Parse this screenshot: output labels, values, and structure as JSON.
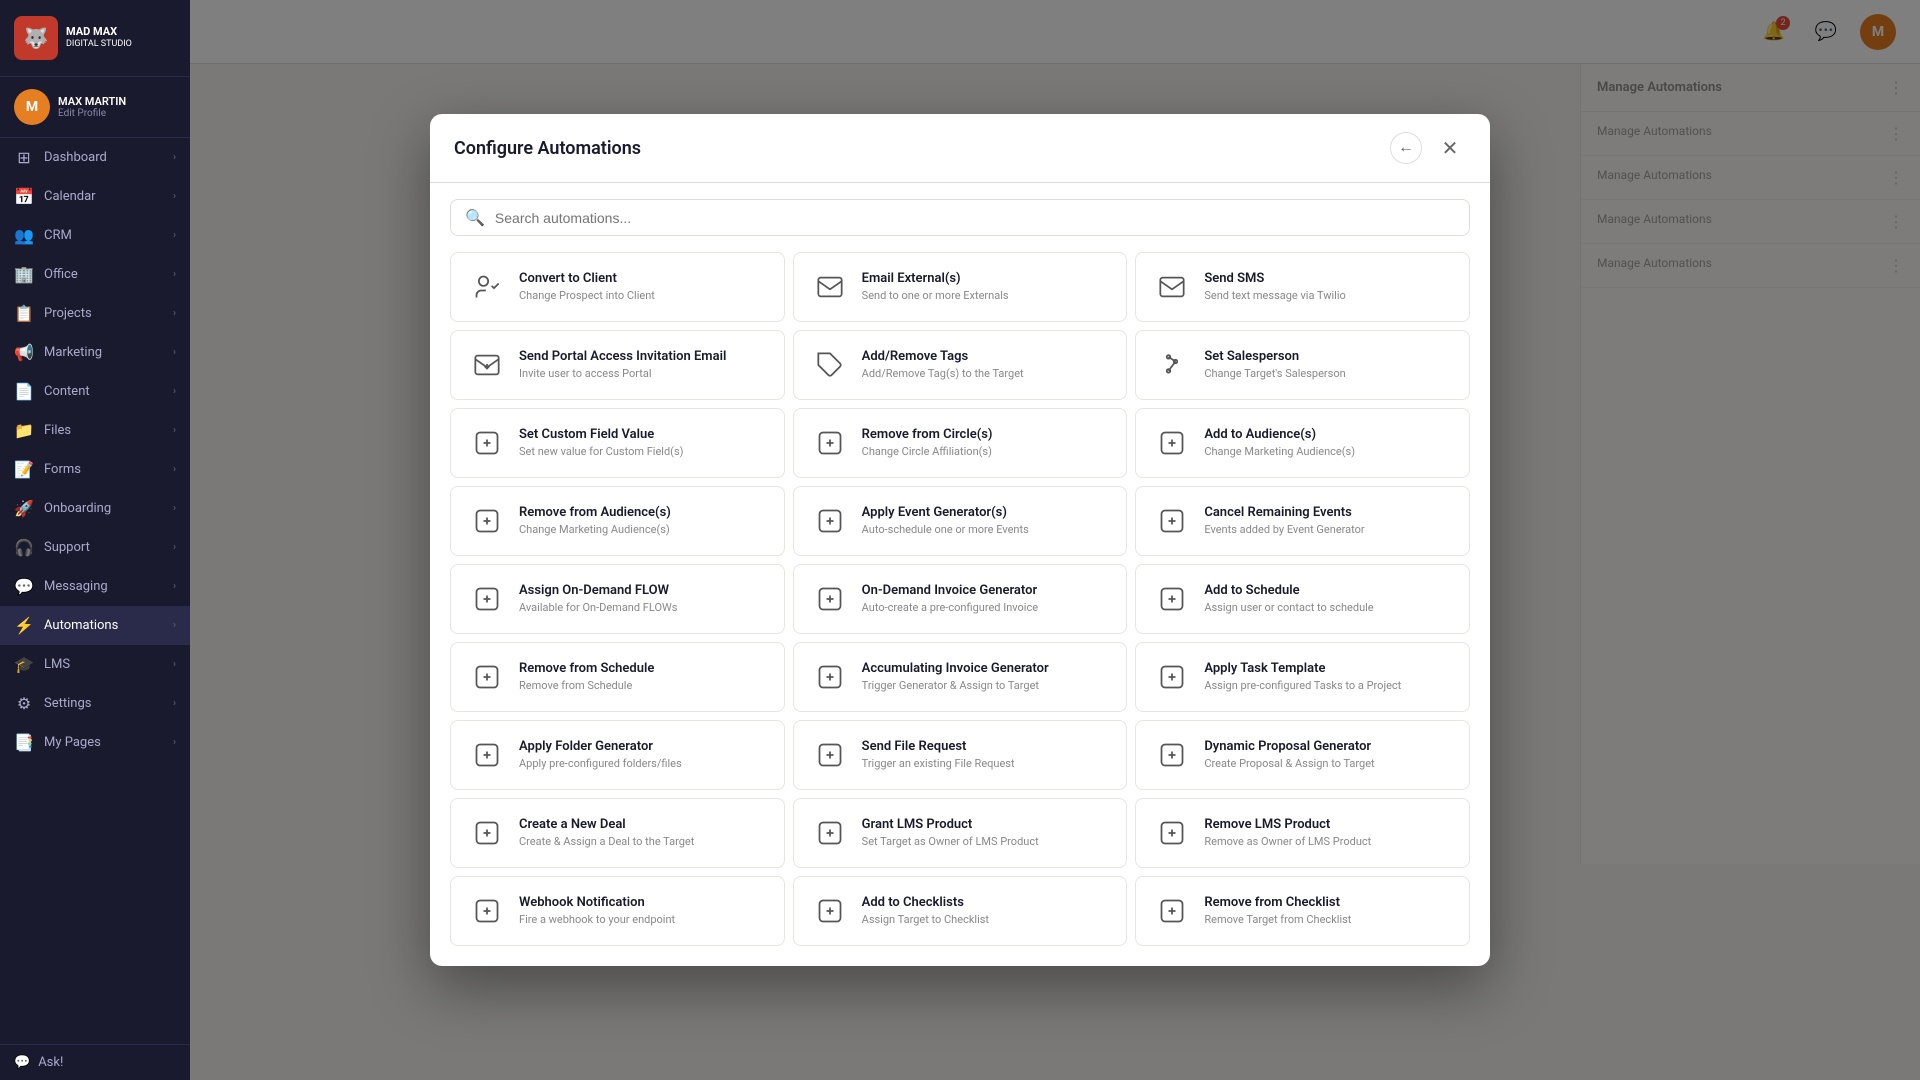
{
  "app": {
    "name": "MAD MAX",
    "subtitle": "digital studio"
  },
  "sidebar": {
    "user": {
      "name": "MAX MARTIN",
      "edit": "Edit Profile"
    },
    "items": [
      {
        "label": "Dashboard",
        "icon": "⊞",
        "hasChildren": true
      },
      {
        "label": "Calendar",
        "icon": "📅",
        "hasChildren": true
      },
      {
        "label": "CRM",
        "icon": "👥",
        "hasChildren": true
      },
      {
        "label": "Office",
        "icon": "🏢",
        "hasChildren": true
      },
      {
        "label": "Projects",
        "icon": "📋",
        "hasChildren": true
      },
      {
        "label": "Marketing",
        "icon": "📢",
        "hasChildren": true
      },
      {
        "label": "Content",
        "icon": "📄",
        "hasChildren": true
      },
      {
        "label": "Files",
        "icon": "📁",
        "hasChildren": true
      },
      {
        "label": "Forms",
        "icon": "📝",
        "hasChildren": true
      },
      {
        "label": "Onboarding",
        "icon": "🚀",
        "hasChildren": true
      },
      {
        "label": "Support",
        "icon": "🎧",
        "hasChildren": true
      },
      {
        "label": "Messaging",
        "icon": "💬",
        "hasChildren": true
      },
      {
        "label": "Automations",
        "icon": "⚡",
        "hasChildren": true,
        "active": true
      },
      {
        "label": "LMS",
        "icon": "🎓",
        "hasChildren": true
      },
      {
        "label": "Settings",
        "icon": "⚙",
        "hasChildren": true
      },
      {
        "label": "My Pages",
        "icon": "📑",
        "hasChildren": true
      }
    ],
    "askLabel": "Ask!"
  },
  "header": {
    "notif_count": "2"
  },
  "modal": {
    "title": "Configure Automations",
    "search_placeholder": "Search automations...",
    "close_label": "✕",
    "back_label": "←",
    "items": [
      {
        "id": "convert-to-client",
        "title": "Convert to Client",
        "desc": "Change Prospect into Client",
        "icon": "👤"
      },
      {
        "id": "email-externals",
        "title": "Email External(s)",
        "desc": "Send to one or more Externals",
        "icon": "@"
      },
      {
        "id": "send-sms",
        "title": "Send SMS",
        "desc": "Send text message via Twilio",
        "icon": "@"
      },
      {
        "id": "send-portal-access",
        "title": "Send Portal Access Invitation Email",
        "desc": "Invite user to access Portal",
        "icon": "✉"
      },
      {
        "id": "add-remove-tags",
        "title": "Add/Remove Tags",
        "desc": "Add/Remove Tag(s) to the Target",
        "icon": "🏷"
      },
      {
        "id": "set-salesperson",
        "title": "Set Salesperson",
        "desc": "Change Target's Salesperson",
        "icon": "⚙"
      },
      {
        "id": "set-custom-field",
        "title": "Set Custom Field Value",
        "desc": "Set new value for Custom Field(s)",
        "icon": "⊞"
      },
      {
        "id": "remove-from-circles",
        "title": "Remove from Circle(s)",
        "desc": "Change Circle Affiliation(s)",
        "icon": "◎"
      },
      {
        "id": "add-to-audiences",
        "title": "Add to Audience(s)",
        "desc": "Change Marketing Audience(s)",
        "icon": "🎯"
      },
      {
        "id": "remove-from-audiences",
        "title": "Remove from Audience(s)",
        "desc": "Change Marketing Audience(s)",
        "icon": "🎯"
      },
      {
        "id": "apply-event-generator",
        "title": "Apply Event Generator(s)",
        "desc": "Auto-schedule one or more Events",
        "icon": "📅"
      },
      {
        "id": "cancel-remaining-events",
        "title": "Cancel Remaining Events",
        "desc": "Events added by Event Generator",
        "icon": "📅"
      },
      {
        "id": "assign-on-demand-flow",
        "title": "Assign On-Demand FLOW",
        "desc": "Available for On-Demand FLOWs",
        "icon": "»"
      },
      {
        "id": "on-demand-invoice-generator",
        "title": "On-Demand Invoice Generator",
        "desc": "Auto-create a pre-configured Invoice",
        "icon": "📋"
      },
      {
        "id": "add-to-schedule",
        "title": "Add to Schedule",
        "desc": "Assign user or contact to schedule",
        "icon": "🕐"
      },
      {
        "id": "remove-from-schedule",
        "title": "Remove from Schedule",
        "desc": "Remove from Schedule",
        "icon": "🕐"
      },
      {
        "id": "accumulating-invoice-generator",
        "title": "Accumulating Invoice Generator",
        "desc": "Trigger Generator & Assign to Target",
        "icon": "⚙"
      },
      {
        "id": "apply-task-template",
        "title": "Apply Task Template",
        "desc": "Assign pre-configured Tasks to a Project",
        "icon": "✅"
      },
      {
        "id": "apply-folder-generator",
        "title": "Apply Folder Generator",
        "desc": "Apply pre-configured folders/files",
        "icon": "📁"
      },
      {
        "id": "send-file-request",
        "title": "Send File Request",
        "desc": "Trigger an existing File Request",
        "icon": "📎"
      },
      {
        "id": "dynamic-proposal-generator",
        "title": "Dynamic Proposal Generator",
        "desc": "Create Proposal & Assign to Target",
        "icon": "⚙"
      },
      {
        "id": "create-new-deal",
        "title": "Create a New Deal",
        "desc": "Create & Assign a Deal to the Target",
        "icon": "💼"
      },
      {
        "id": "grant-lms-product",
        "title": "Grant LMS Product",
        "desc": "Set Target as Owner of LMS Product",
        "icon": "🎓"
      },
      {
        "id": "remove-lms-product",
        "title": "Remove LMS Product",
        "desc": "Remove as Owner of LMS Product",
        "icon": "🎓"
      },
      {
        "id": "webhook-notification",
        "title": "Webhook Notification",
        "desc": "Fire a webhook to your endpoint",
        "icon": "⚙"
      },
      {
        "id": "add-to-checklists",
        "title": "Add to Checklists",
        "desc": "Assign Target to Checklist",
        "icon": "✅"
      },
      {
        "id": "remove-from-checklist",
        "title": "Remove from Checklist",
        "desc": "Remove Target from Checklist",
        "icon": "✅"
      }
    ]
  },
  "rightPanel": {
    "rows": [
      {
        "label": "Manage Automations"
      },
      {
        "label": "Manage Automations"
      },
      {
        "label": "Manage Automations"
      },
      {
        "label": "Manage Automations"
      }
    ]
  }
}
